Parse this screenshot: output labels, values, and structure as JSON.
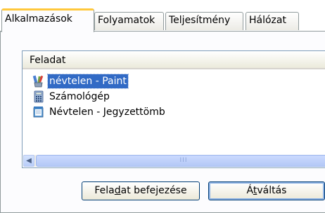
{
  "tabs": [
    {
      "label": "Alkalmazások",
      "active": true
    },
    {
      "label": "Folyamatok",
      "active": false
    },
    {
      "label": "Teljesítmény",
      "active": false
    },
    {
      "label": "Hálózat",
      "active": false
    }
  ],
  "task_list": {
    "column_header": "Feladat",
    "rows": [
      {
        "label": "névtelen - Paint",
        "icon": "paint-icon",
        "selected": true
      },
      {
        "label": "Számológép",
        "icon": "calculator-icon",
        "selected": false
      },
      {
        "label": "Névtelen - Jegyzettömb",
        "icon": "notepad-icon",
        "selected": false
      }
    ],
    "scrollbar_grip": "III"
  },
  "buttons": {
    "end_task": {
      "before": "Fela",
      "accel": "d",
      "after": "at befejezése"
    },
    "switch_to": {
      "before": "Á",
      "accel": "t",
      "after": "váltás"
    }
  },
  "colors": {
    "selection": "#316ac5",
    "active_tab_highlight": "#ffc83c",
    "border": "#919b9c"
  }
}
